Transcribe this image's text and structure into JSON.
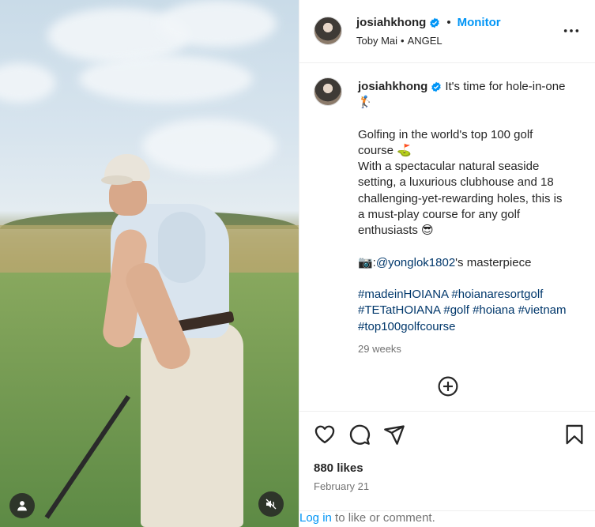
{
  "media": {
    "user_icon": "user-icon",
    "mute_icon": "volume-muted-icon",
    "colors": {
      "sky": "#c9dbe8",
      "grass": "#6d9450"
    }
  },
  "post": {
    "username": "josiahkhong",
    "verified": true,
    "separator": "•",
    "follow_label": "Monitor",
    "audio_artist": "Toby Mai",
    "audio_separator": "•",
    "audio_title": "ANGEL",
    "more_icon": "more-horizontal-icon"
  },
  "caption": {
    "username": "josiahkhong",
    "line_1": "It's time for hole-in-one 🏌️",
    "line_2": "Golfing in the world's top 100 golf course ⛳",
    "line_3": "With a spectacular natural seaside setting, a luxurious clubhouse and 18 challenging-yet-rewarding holes, this is a must-play course for any golf enthusiasts 😎",
    "credit_prefix": "📷:",
    "credit_mention": "@yonglok1802",
    "credit_suffix": "'s masterpiece",
    "hashtags": [
      "#madeinHOIANA",
      "#hoianaresortgolf",
      "#TETatHOIANA",
      "#golf",
      "#hoiana",
      "#vietnam",
      "#top100golfcourse"
    ],
    "timestamp": "29 weeks"
  },
  "actions": {
    "like_icon": "heart-icon",
    "comment_icon": "comment-icon",
    "share_icon": "send-icon",
    "save_icon": "bookmark-icon",
    "add_comment_icon": "plus-circle-icon",
    "likes": "880 likes",
    "date": "February 21",
    "login_link": "Log in",
    "login_suffix": " to like or comment."
  },
  "colors": {
    "accent": "#0095f6",
    "hashtag": "#00376b",
    "muted": "#737373",
    "text": "#262626",
    "divider": "#efefef"
  }
}
